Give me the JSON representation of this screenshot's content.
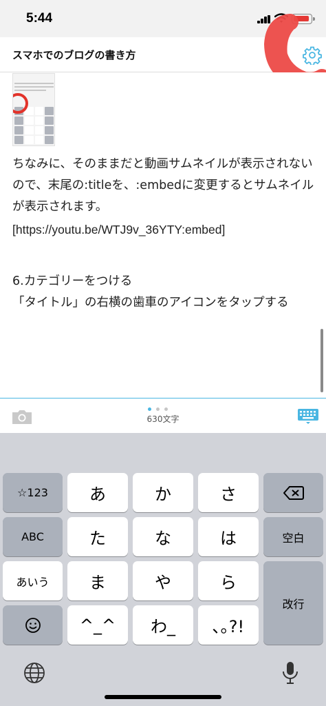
{
  "status_bar": {
    "time": "5:44"
  },
  "header": {
    "title": "スマホでのブログの書き方",
    "settings_icon": "gear-icon"
  },
  "editor": {
    "paragraph": "ちなみに、そのままだと動画サムネイルが表示されないので、末尾の:titleを、:embedに変更するとサムネイルが表示されます。",
    "embed_url": "[https://youtu.be/WTJ9v_36YTY:embed]",
    "step_heading": "6.カテゴリーをつける",
    "step_text": "「タイトル」の右横の歯車のアイコンをタップする"
  },
  "toolbar": {
    "char_count": "630文字",
    "page_dots": 3,
    "active_dot": 1
  },
  "keyboard": {
    "row1": [
      "☆123",
      "あ",
      "か",
      "さ",
      "⌫"
    ],
    "row2": [
      "ABC",
      "た",
      "な",
      "は",
      "空白"
    ],
    "row3": [
      "あいう",
      "ま",
      "や",
      "ら"
    ],
    "row4": [
      "☺",
      "^_^",
      "わ_",
      "､｡?!"
    ],
    "enter": "改行"
  },
  "colors": {
    "accent": "#49b6e2",
    "annotation": "#e2332a",
    "battery": "#e53935"
  }
}
